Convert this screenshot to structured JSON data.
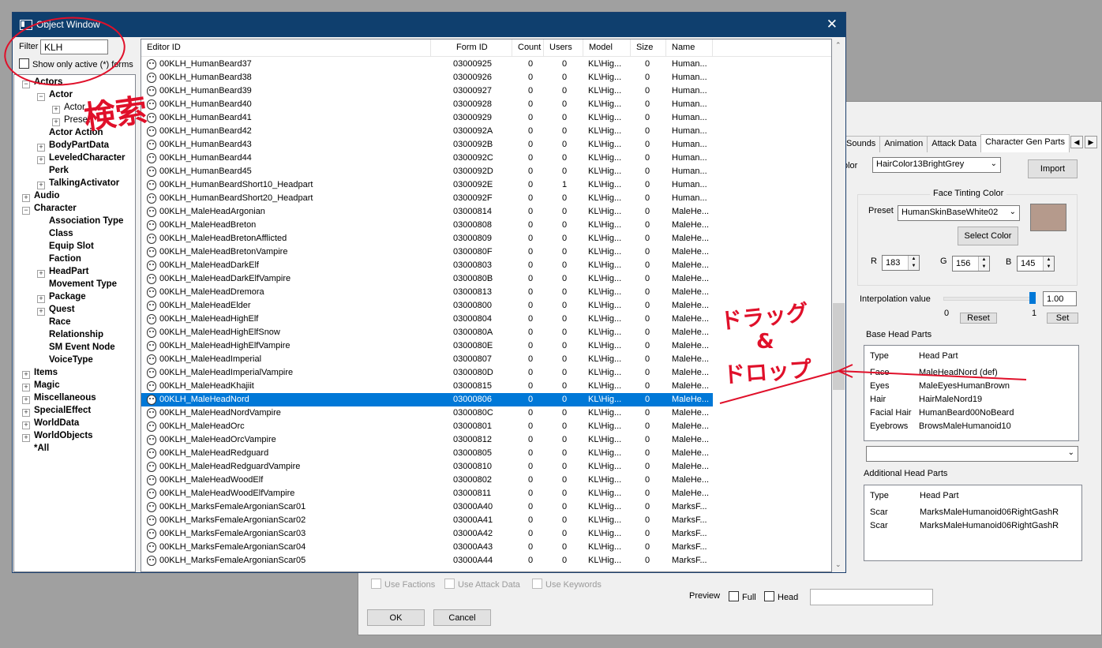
{
  "object_window": {
    "title": "Object Window",
    "filter_label": "Filter",
    "filter_value": "KLH",
    "show_active_label": "Show only active (*) forms",
    "tree": [
      {
        "label": "Actors",
        "level": 0,
        "exp": "-"
      },
      {
        "label": "Actor",
        "level": 1,
        "exp": "-"
      },
      {
        "label": "Actor",
        "level": 2,
        "exp": "+",
        "normal": true
      },
      {
        "label": "Preset",
        "level": 2,
        "exp": "+",
        "normal": true
      },
      {
        "label": "Actor Action",
        "level": 1,
        "exp": ""
      },
      {
        "label": "BodyPartData",
        "level": 1,
        "exp": "+"
      },
      {
        "label": "LeveledCharacter",
        "level": 1,
        "exp": "+"
      },
      {
        "label": "Perk",
        "level": 1,
        "exp": ""
      },
      {
        "label": "TalkingActivator",
        "level": 1,
        "exp": "+"
      },
      {
        "label": "Audio",
        "level": 0,
        "exp": "+"
      },
      {
        "label": "Character",
        "level": 0,
        "exp": "-"
      },
      {
        "label": "Association Type",
        "level": 1,
        "exp": ""
      },
      {
        "label": "Class",
        "level": 1,
        "exp": ""
      },
      {
        "label": "Equip Slot",
        "level": 1,
        "exp": ""
      },
      {
        "label": "Faction",
        "level": 1,
        "exp": ""
      },
      {
        "label": "HeadPart",
        "level": 1,
        "exp": "+"
      },
      {
        "label": "Movement Type",
        "level": 1,
        "exp": ""
      },
      {
        "label": "Package",
        "level": 1,
        "exp": "+"
      },
      {
        "label": "Quest",
        "level": 1,
        "exp": "+"
      },
      {
        "label": "Race",
        "level": 1,
        "exp": ""
      },
      {
        "label": "Relationship",
        "level": 1,
        "exp": ""
      },
      {
        "label": "SM Event Node",
        "level": 1,
        "exp": ""
      },
      {
        "label": "VoiceType",
        "level": 1,
        "exp": ""
      },
      {
        "label": "Items",
        "level": 0,
        "exp": "+"
      },
      {
        "label": "Magic",
        "level": 0,
        "exp": "+"
      },
      {
        "label": "Miscellaneous",
        "level": 0,
        "exp": "+"
      },
      {
        "label": "SpecialEffect",
        "level": 0,
        "exp": "+"
      },
      {
        "label": "WorldData",
        "level": 0,
        "exp": "+"
      },
      {
        "label": "WorldObjects",
        "level": 0,
        "exp": "+"
      },
      {
        "label": "*All",
        "level": 0,
        "exp": ""
      }
    ],
    "columns": [
      "Editor ID",
      "Form ID",
      "Count",
      "Users",
      "Model",
      "Size",
      "Name"
    ],
    "rows": [
      [
        "00KLH_HumanBeard37",
        "03000925",
        "0",
        "0",
        "KL\\Hig...",
        "0",
        "Human..."
      ],
      [
        "00KLH_HumanBeard38",
        "03000926",
        "0",
        "0",
        "KL\\Hig...",
        "0",
        "Human..."
      ],
      [
        "00KLH_HumanBeard39",
        "03000927",
        "0",
        "0",
        "KL\\Hig...",
        "0",
        "Human..."
      ],
      [
        "00KLH_HumanBeard40",
        "03000928",
        "0",
        "0",
        "KL\\Hig...",
        "0",
        "Human..."
      ],
      [
        "00KLH_HumanBeard41",
        "03000929",
        "0",
        "0",
        "KL\\Hig...",
        "0",
        "Human..."
      ],
      [
        "00KLH_HumanBeard42",
        "0300092A",
        "0",
        "0",
        "KL\\Hig...",
        "0",
        "Human..."
      ],
      [
        "00KLH_HumanBeard43",
        "0300092B",
        "0",
        "0",
        "KL\\Hig...",
        "0",
        "Human..."
      ],
      [
        "00KLH_HumanBeard44",
        "0300092C",
        "0",
        "0",
        "KL\\Hig...",
        "0",
        "Human..."
      ],
      [
        "00KLH_HumanBeard45",
        "0300092D",
        "0",
        "0",
        "KL\\Hig...",
        "0",
        "Human..."
      ],
      [
        "00KLH_HumanBeardShort10_Headpart",
        "0300092E",
        "0",
        "1",
        "KL\\Hig...",
        "0",
        "Human..."
      ],
      [
        "00KLH_HumanBeardShort20_Headpart",
        "0300092F",
        "0",
        "0",
        "KL\\Hig...",
        "0",
        "Human..."
      ],
      [
        "00KLH_MaleHeadArgonian",
        "03000814",
        "0",
        "0",
        "KL\\Hig...",
        "0",
        "MaleHe..."
      ],
      [
        "00KLH_MaleHeadBreton",
        "03000808",
        "0",
        "0",
        "KL\\Hig...",
        "0",
        "MaleHe..."
      ],
      [
        "00KLH_MaleHeadBretonAfflicted",
        "03000809",
        "0",
        "0",
        "KL\\Hig...",
        "0",
        "MaleHe..."
      ],
      [
        "00KLH_MaleHeadBretonVampire",
        "0300080F",
        "0",
        "0",
        "KL\\Hig...",
        "0",
        "MaleHe..."
      ],
      [
        "00KLH_MaleHeadDarkElf",
        "03000803",
        "0",
        "0",
        "KL\\Hig...",
        "0",
        "MaleHe..."
      ],
      [
        "00KLH_MaleHeadDarkElfVampire",
        "0300080B",
        "0",
        "0",
        "KL\\Hig...",
        "0",
        "MaleHe..."
      ],
      [
        "00KLH_MaleHeadDremora",
        "03000813",
        "0",
        "0",
        "KL\\Hig...",
        "0",
        "MaleHe..."
      ],
      [
        "00KLH_MaleHeadElder",
        "03000800",
        "0",
        "0",
        "KL\\Hig...",
        "0",
        "MaleHe..."
      ],
      [
        "00KLH_MaleHeadHighElf",
        "03000804",
        "0",
        "0",
        "KL\\Hig...",
        "0",
        "MaleHe..."
      ],
      [
        "00KLH_MaleHeadHighElfSnow",
        "0300080A",
        "0",
        "0",
        "KL\\Hig...",
        "0",
        "MaleHe..."
      ],
      [
        "00KLH_MaleHeadHighElfVampire",
        "0300080E",
        "0",
        "0",
        "KL\\Hig...",
        "0",
        "MaleHe..."
      ],
      [
        "00KLH_MaleHeadImperial",
        "03000807",
        "0",
        "0",
        "KL\\Hig...",
        "0",
        "MaleHe..."
      ],
      [
        "00KLH_MaleHeadImperialVampire",
        "0300080D",
        "0",
        "0",
        "KL\\Hig...",
        "0",
        "MaleHe..."
      ],
      [
        "00KLH_MaleHeadKhajiit",
        "03000815",
        "0",
        "0",
        "KL\\Hig...",
        "0",
        "MaleHe..."
      ],
      [
        "00KLH_MaleHeadNord",
        "03000806",
        "0",
        "0",
        "KL\\Hig...",
        "0",
        "MaleHe..."
      ],
      [
        "00KLH_MaleHeadNordVampire",
        "0300080C",
        "0",
        "0",
        "KL\\Hig...",
        "0",
        "MaleHe..."
      ],
      [
        "00KLH_MaleHeadOrc",
        "03000801",
        "0",
        "0",
        "KL\\Hig...",
        "0",
        "MaleHe..."
      ],
      [
        "00KLH_MaleHeadOrcVampire",
        "03000812",
        "0",
        "0",
        "KL\\Hig...",
        "0",
        "MaleHe..."
      ],
      [
        "00KLH_MaleHeadRedguard",
        "03000805",
        "0",
        "0",
        "KL\\Hig...",
        "0",
        "MaleHe..."
      ],
      [
        "00KLH_MaleHeadRedguardVampire",
        "03000810",
        "0",
        "0",
        "KL\\Hig...",
        "0",
        "MaleHe..."
      ],
      [
        "00KLH_MaleHeadWoodElf",
        "03000802",
        "0",
        "0",
        "KL\\Hig...",
        "0",
        "MaleHe..."
      ],
      [
        "00KLH_MaleHeadWoodElfVampire",
        "03000811",
        "0",
        "0",
        "KL\\Hig...",
        "0",
        "MaleHe..."
      ],
      [
        "00KLH_MarksFemaleArgonianScar01",
        "03000A40",
        "0",
        "0",
        "KL\\Hig...",
        "0",
        "MarksF..."
      ],
      [
        "00KLH_MarksFemaleArgonianScar02",
        "03000A41",
        "0",
        "0",
        "KL\\Hig...",
        "0",
        "MarksF..."
      ],
      [
        "00KLH_MarksFemaleArgonianScar03",
        "03000A42",
        "0",
        "0",
        "KL\\Hig...",
        "0",
        "MarksF..."
      ],
      [
        "00KLH_MarksFemaleArgonianScar04",
        "03000A43",
        "0",
        "0",
        "KL\\Hig...",
        "0",
        "MarksF..."
      ],
      [
        "00KLH_MarksFemaleArgonianScar05",
        "03000A44",
        "0",
        "0",
        "KL\\Hig...",
        "0",
        "MarksF..."
      ]
    ],
    "selected_row": 25
  },
  "npc_window": {
    "tabs": [
      "Sounds",
      "Animation",
      "Attack Data",
      "Character Gen Parts"
    ],
    "active_tab": 3,
    "hair_color_label": "olor",
    "hair_color_value": "HairColor13BrightGrey",
    "import_label": "Import",
    "face_tint_title": "Face Tinting Color",
    "preset_label": "Preset",
    "preset_value": "HumanSkinBaseWhite02",
    "select_color_label": "Select Color",
    "tint_swatch_color": "#b59a8c",
    "r_label": "R",
    "r_value": "183",
    "g_label": "G",
    "g_value": "156",
    "b_label": "B",
    "b_value": "145",
    "interp_label": "Interpolation value",
    "interp_value": "1.00",
    "interp_fraction": 1.0,
    "interp_min": "0",
    "interp_max": "1",
    "reset_label": "Reset",
    "set_label": "Set",
    "base_parts_title": "Base Head Parts",
    "base_cols": [
      "Type",
      "Head Part"
    ],
    "base_rows": [
      [
        "Face",
        "MaleHeadNord (def)"
      ],
      [
        "Eyes",
        "MaleEyesHumanBrown"
      ],
      [
        "Hair",
        "HairMaleNord19"
      ],
      [
        "Facial Hair",
        "HumanBeard00NoBeard"
      ],
      [
        "Eyebrows",
        "BrowsMaleHumanoid10"
      ]
    ],
    "additional_title": "Additional Head Parts",
    "add_cols": [
      "Type",
      "Head Part"
    ],
    "add_rows": [
      [
        "Scar",
        "MarksMaleHumanoid06RightGashR"
      ],
      [
        "Scar",
        "MarksMaleHumanoid06RightGashR"
      ]
    ],
    "use_factions_label": "Use Factions",
    "use_attack_label": "Use Attack Data",
    "use_keywords_label": "Use Keywords",
    "ok_label": "OK",
    "cancel_label": "Cancel",
    "preview_label": "Preview",
    "full_label": "Full",
    "head_label": "Head"
  },
  "annotations": {
    "search_note": "検索",
    "drag_note_1": "ドラッグ",
    "drag_note_amp": "&",
    "drag_note_2": "ドロップ",
    "ink_color": "#e0102a"
  }
}
